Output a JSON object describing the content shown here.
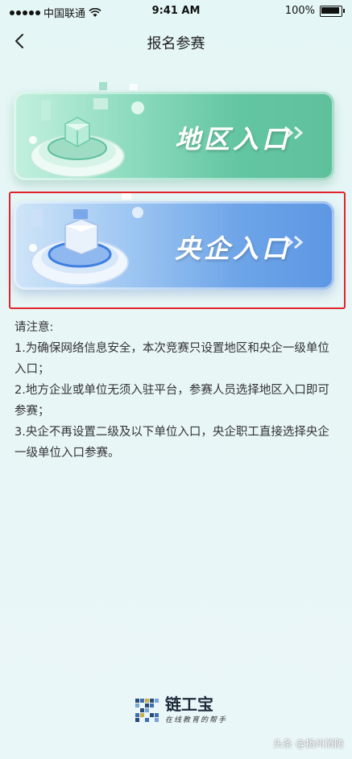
{
  "status_bar": {
    "carrier": "中国联通",
    "time": "9:41 AM",
    "battery": "100%"
  },
  "nav": {
    "title": "报名参赛"
  },
  "entries": [
    {
      "label": "地区入口",
      "color": "#63c6a3"
    },
    {
      "label": "央企入口",
      "color": "#6ea5e8"
    }
  ],
  "notes": {
    "heading": "请注意:",
    "items": [
      "1.为确保网络信息安全，本次竞赛只设置地区和央企一级单位入口；",
      "2.地方企业或单位无须入驻平台，参赛人员选择地区入口即可参赛；",
      "3.央企不再设置二级及以下单位入口，央企职工直接选择央企一级单位入口参赛。"
    ]
  },
  "footer": {
    "logo_name": "链工宝",
    "logo_slogan": "在线教育的帮手",
    "watermark": "头条 @扬州消防"
  },
  "colors": {
    "highlight": "#e0242c",
    "green_card": "#63c6a3",
    "blue_card": "#6ea5e8"
  }
}
